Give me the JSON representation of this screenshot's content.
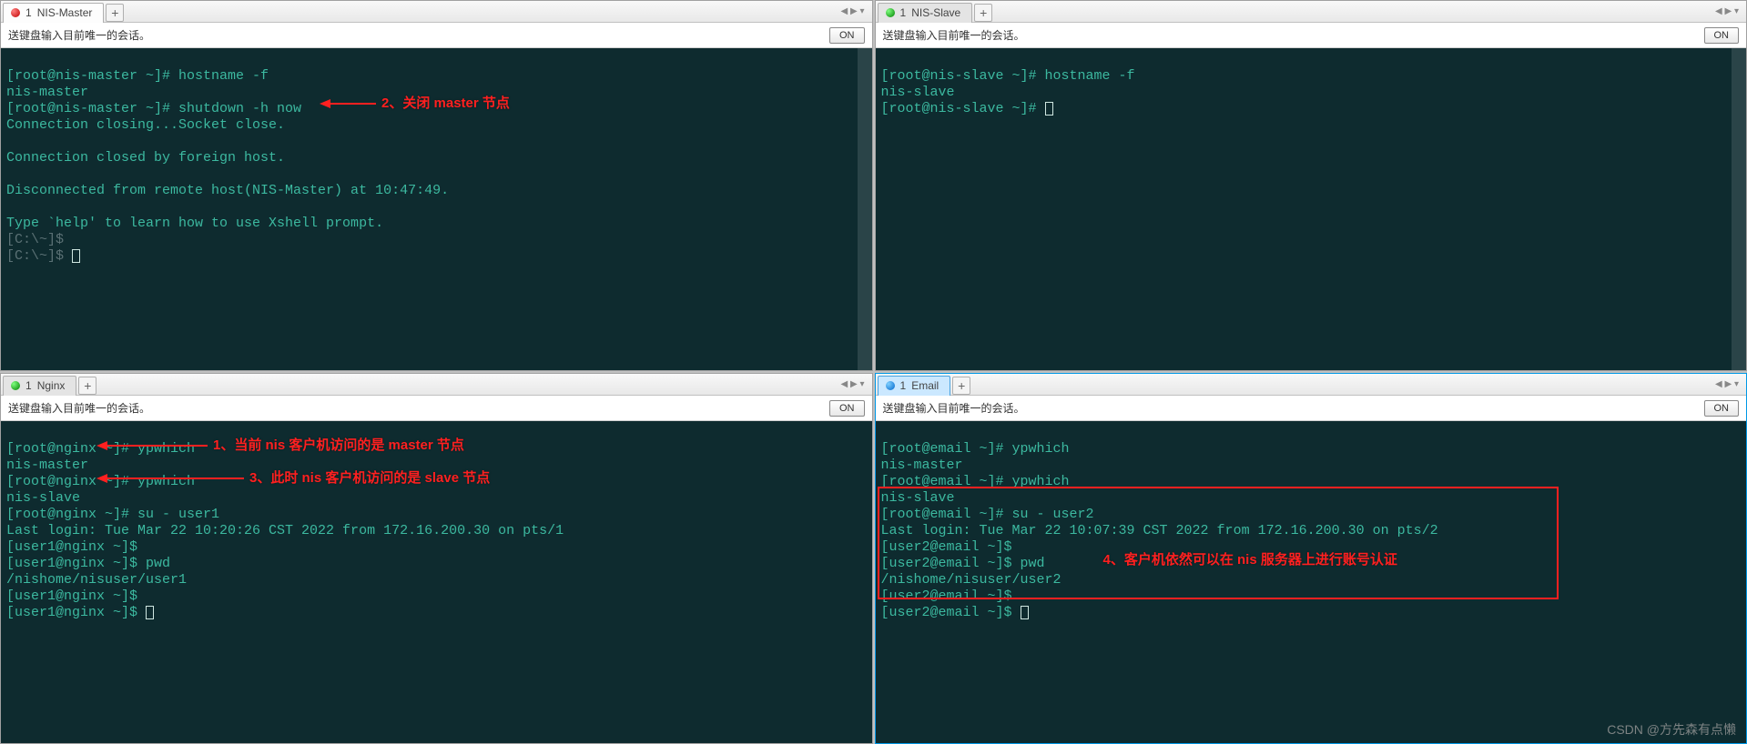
{
  "panes": {
    "master": {
      "tab_number": "1",
      "tab_name": "NIS-Master",
      "info_text": "送键盘输入目前唯一的会话。",
      "on_label": "ON",
      "term": {
        "l1": "[root@nis-master ~]# hostname -f",
        "l2": "nis-master",
        "l3": "[root@nis-master ~]# shutdown -h now",
        "l4": "Connection closing...Socket close.",
        "l5": "",
        "l6": "Connection closed by foreign host.",
        "l7": "",
        "l8": "Disconnected from remote host(NIS-Master) at 10:47:49.",
        "l9": "",
        "l10": "Type `help' to learn how to use Xshell prompt.",
        "l11": "[C:\\~]$",
        "l12": "[C:\\~]$ "
      },
      "annotation2": "2、关闭 master 节点"
    },
    "slave": {
      "tab_number": "1",
      "tab_name": "NIS-Slave",
      "info_text": "送键盘输入目前唯一的会话。",
      "on_label": "ON",
      "term": {
        "l1": "[root@nis-slave ~]# hostname -f",
        "l2": "nis-slave",
        "l3": "[root@nis-slave ~]# "
      }
    },
    "nginx": {
      "tab_number": "1",
      "tab_name": "Nginx",
      "info_text": "送键盘输入目前唯一的会话。",
      "on_label": "ON",
      "term": {
        "l1": "[root@nginx ~]# ypwhich",
        "l2": "nis-master",
        "l3": "[root@nginx ~]# ypwhich",
        "l4": "nis-slave",
        "l5": "[root@nginx ~]# su - user1",
        "l6": "Last login: Tue Mar 22 10:20:26 CST 2022 from 172.16.200.30 on pts/1",
        "l7": "[user1@nginx ~]$",
        "l8": "[user1@nginx ~]$ pwd",
        "l9": "/nishome/nisuser/user1",
        "l10": "[user1@nginx ~]$",
        "l11": "[user1@nginx ~]$ "
      },
      "annotation1": "1、当前 nis 客户机访问的是 master 节点",
      "annotation3": "3、此时 nis 客户机访问的是 slave 节点"
    },
    "email": {
      "tab_number": "1",
      "tab_name": "Email",
      "info_text": "送键盘输入目前唯一的会话。",
      "on_label": "ON",
      "term": {
        "l1": "[root@email ~]# ypwhich",
        "l2": "nis-master",
        "l3": "[root@email ~]# ypwhich",
        "l4": "nis-slave",
        "l5": "[root@email ~]# su - user2",
        "l6": "Last login: Tue Mar 22 10:07:39 CST 2022 from 172.16.200.30 on pts/2",
        "l7": "[user2@email ~]$",
        "l8": "[user2@email ~]$ pwd",
        "l9": "/nishome/nisuser/user2",
        "l10": "[user2@email ~]$",
        "l11": "[user2@email ~]$ "
      },
      "annotation4": "4、客户机依然可以在 nis 服务器上进行账号认证"
    }
  },
  "watermark": "CSDN @方先森有点懒"
}
